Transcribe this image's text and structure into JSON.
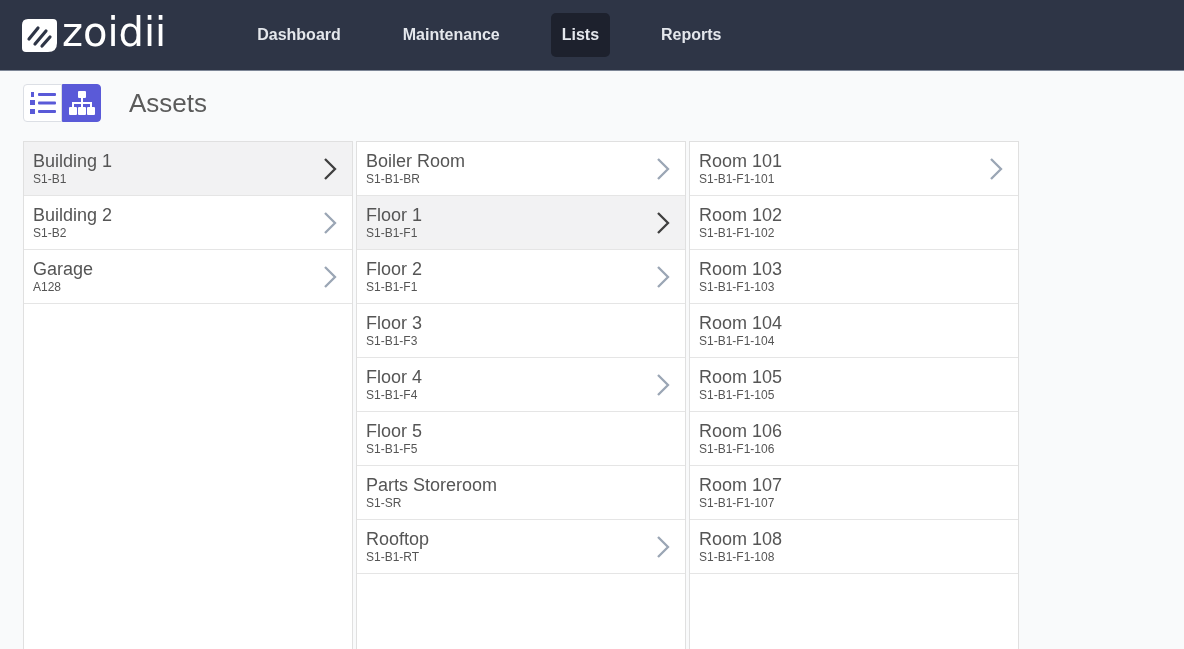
{
  "header": {
    "logo": "zoidii",
    "nav": [
      {
        "label": "Dashboard",
        "selected": false
      },
      {
        "label": "Maintenance",
        "selected": false
      },
      {
        "label": "Lists",
        "selected": true
      },
      {
        "label": "Reports",
        "selected": false
      }
    ]
  },
  "page": {
    "view_toggle": [
      {
        "kind": "list",
        "selected": false
      },
      {
        "kind": "tree",
        "selected": true
      }
    ],
    "title": "Assets"
  },
  "columns": [
    {
      "items": [
        {
          "name": "Building 1",
          "code": "S1-B1",
          "selected": true,
          "expandable": true
        },
        {
          "name": "Building 2",
          "code": "S1-B2",
          "selected": false,
          "expandable": true
        },
        {
          "name": "Garage",
          "code": "A128",
          "selected": false,
          "expandable": true
        }
      ]
    },
    {
      "items": [
        {
          "name": "Boiler Room",
          "code": "S1-B1-BR",
          "selected": false,
          "expandable": true
        },
        {
          "name": "Floor 1",
          "code": "S1-B1-F1",
          "selected": true,
          "expandable": true
        },
        {
          "name": "Floor 2",
          "code": "S1-B1-F1",
          "selected": false,
          "expandable": true
        },
        {
          "name": "Floor 3",
          "code": "S1-B1-F3",
          "selected": false,
          "expandable": false
        },
        {
          "name": "Floor 4",
          "code": "S1-B1-F4",
          "selected": false,
          "expandable": true
        },
        {
          "name": "Floor 5",
          "code": "S1-B1-F5",
          "selected": false,
          "expandable": false
        },
        {
          "name": "Parts Storeroom",
          "code": "S1-SR",
          "selected": false,
          "expandable": false
        },
        {
          "name": "Rooftop",
          "code": "S1-B1-RT",
          "selected": false,
          "expandable": true
        }
      ]
    },
    {
      "items": [
        {
          "name": "Room 101",
          "code": "S1-B1-F1-101",
          "selected": false,
          "expandable": true
        },
        {
          "name": "Room 102",
          "code": "S1-B1-F1-102",
          "selected": false,
          "expandable": false
        },
        {
          "name": "Room 103",
          "code": "S1-B1-F1-103",
          "selected": false,
          "expandable": false
        },
        {
          "name": "Room 104",
          "code": "S1-B1-F1-104",
          "selected": false,
          "expandable": false
        },
        {
          "name": "Room 105",
          "code": "S1-B1-F1-105",
          "selected": false,
          "expandable": false
        },
        {
          "name": "Room 106",
          "code": "S1-B1-F1-106",
          "selected": false,
          "expandable": false
        },
        {
          "name": "Room 107",
          "code": "S1-B1-F1-107",
          "selected": false,
          "expandable": false
        },
        {
          "name": "Room 108",
          "code": "S1-B1-F1-108",
          "selected": false,
          "expandable": false
        }
      ]
    }
  ]
}
